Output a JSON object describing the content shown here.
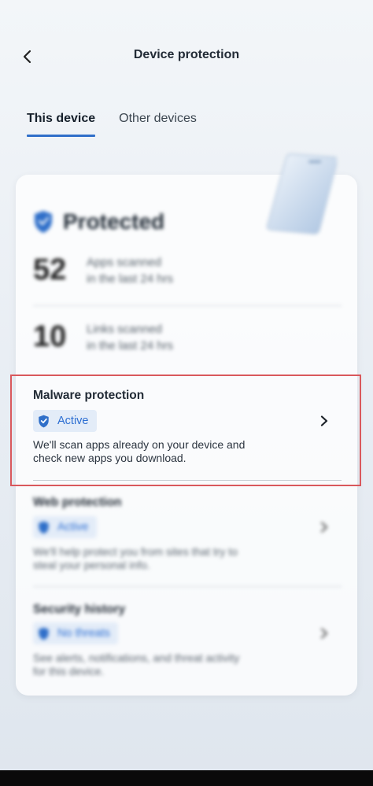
{
  "header": {
    "title": "Device protection",
    "back_icon": "chevron-left-icon"
  },
  "tabs": [
    {
      "label": "This device",
      "active": true
    },
    {
      "label": "Other devices",
      "active": false
    }
  ],
  "status": {
    "title": "Protected",
    "icon": "shield-check-icon",
    "stats": [
      {
        "value": "52",
        "line1": "Apps scanned",
        "line2": "in the last 24 hrs"
      },
      {
        "value": "10",
        "line1": "Links scanned",
        "line2": "in the last 24 hrs"
      }
    ]
  },
  "sections": [
    {
      "title": "Malware protection",
      "badge": "Active",
      "line1": "We'll scan apps already on your device and",
      "line2": "check new apps you download."
    },
    {
      "title": "Web protection",
      "badge": "Active",
      "line1": "We'll help protect you from sites that try to",
      "line2": "steal your personal info."
    },
    {
      "title": "Security history",
      "badge": "No threats",
      "line1": "See alerts, notifications, and threat activity",
      "line2": "for this device."
    }
  ],
  "colors": {
    "accent": "#2f6fc9",
    "badge_bg": "#e3ecf8",
    "highlight": "#d9585c"
  }
}
